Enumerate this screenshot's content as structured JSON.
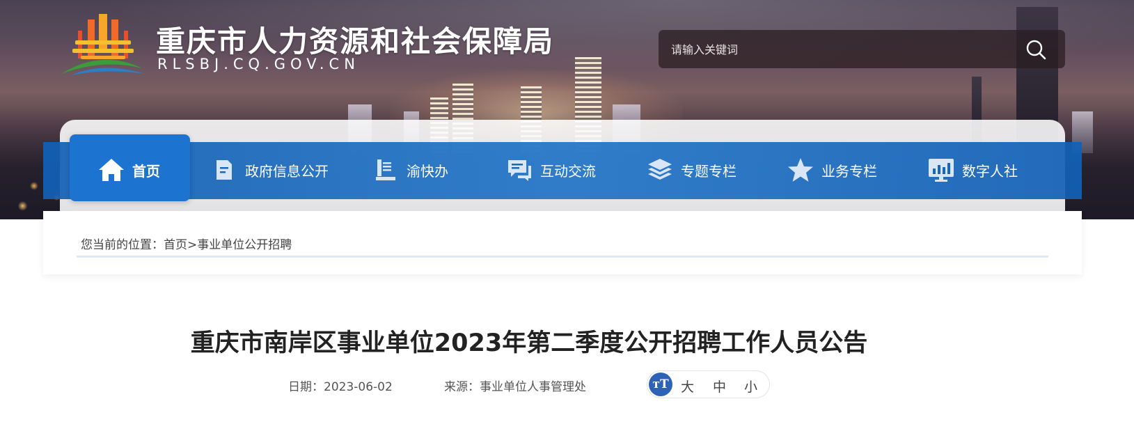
{
  "header": {
    "site_title": "重庆市人力资源和社会保障局",
    "site_domain": "RLSBJ.CQ.GOV.CN",
    "search_placeholder": "请输入关键词"
  },
  "nav": {
    "items": [
      {
        "label": "首页",
        "icon": "home-icon"
      },
      {
        "label": "政府信息公开",
        "icon": "document-icon"
      },
      {
        "label": "渝快办",
        "icon": "book-icon"
      },
      {
        "label": "互动交流",
        "icon": "chat-icon"
      },
      {
        "label": "专题专栏",
        "icon": "layers-icon"
      },
      {
        "label": "业务专栏",
        "icon": "star-icon"
      },
      {
        "label": "数字人社",
        "icon": "monitor-chart-icon"
      }
    ]
  },
  "breadcrumb": {
    "prefix": "您当前的位置：",
    "home": "首页",
    "separator": ">",
    "current": "事业单位公开招聘"
  },
  "article": {
    "title": "重庆市南岸区事业单位2023年第二季度公开招聘工作人员公告",
    "date_label": "日期：2023-06-02",
    "source_label": "来源：事业单位人事管理处"
  },
  "font_size": {
    "icon_text": "тT",
    "large": "大",
    "medium": "中",
    "small": "小"
  },
  "colors": {
    "nav_blue": "#1260b6",
    "nav_active": "#1d74d0",
    "font_icon_bg": "#2d62b7"
  }
}
